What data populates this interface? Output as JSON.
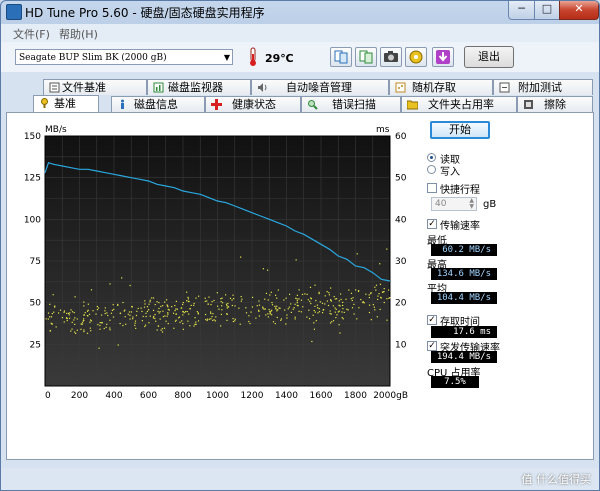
{
  "window": {
    "title": "HD Tune Pro 5.60 - 硬盘/固态硬盘实用程序",
    "minimize": "─",
    "maximize": "□",
    "close": "✕"
  },
  "menu": [
    {
      "label": "文件(F)"
    },
    {
      "label": "帮助(H)"
    }
  ],
  "toolbar": {
    "drive": "Seagate BUP Slim BK (2000 gB)",
    "temperature": "29℃",
    "exit_label": "退出"
  },
  "tabs_top": [
    {
      "label": "文件基准",
      "icon": "file-benchmark-icon"
    },
    {
      "label": "磁盘监视器",
      "icon": "disk-monitor-icon"
    },
    {
      "label": "自动噪音管理",
      "icon": "speaker-icon"
    },
    {
      "label": "随机存取",
      "icon": "random-access-icon"
    },
    {
      "label": "附加测试",
      "icon": "extra-tests-icon"
    }
  ],
  "tabs_bottom": [
    {
      "label": "基准",
      "icon": "benchmark-icon"
    },
    {
      "label": "磁盘信息",
      "icon": "info-icon"
    },
    {
      "label": "健康状态",
      "icon": "health-icon"
    },
    {
      "label": "错误扫描",
      "icon": "error-scan-icon"
    },
    {
      "label": "文件夹占用率",
      "icon": "folder-icon"
    },
    {
      "label": "擦除",
      "icon": "erase-icon"
    }
  ],
  "controls": {
    "start_label": "开始",
    "read_label": "读取",
    "write_label": "写入",
    "read_selected": true,
    "quick_label": "快捷行程",
    "quick_checked": false,
    "quick_value": "40",
    "quick_unit": "gB",
    "transfer_label": "传输速率",
    "transfer_checked": true,
    "min_label": "最低",
    "min_value": "60.2 MB/s",
    "max_label": "最高",
    "max_value": "134.6 MB/s",
    "avg_label": "平均",
    "avg_value": "104.4 MB/s",
    "access_label": "存取时间",
    "access_checked": true,
    "access_value": "17.6 ms",
    "burst_label": "突发传输速率",
    "burst_checked": true,
    "burst_value": "194.4 MB/s",
    "cpu_label": "CPU 占用率",
    "cpu_value": "7.5%"
  },
  "watermark": "值 什么值得买",
  "colors": {
    "transfer_line": "#2aa8e0",
    "access_points": "#e8e84a",
    "plot_bg": "#1c1c1c",
    "grid": "#3a3a3a"
  },
  "chart_data": {
    "type": "line",
    "y_left_label": "MB/s",
    "y_right_label": "ms",
    "x_unit": "gB",
    "x_ticks": [
      "0",
      "200",
      "400",
      "600",
      "800",
      "1000",
      "1200",
      "1400",
      "1600",
      "1800",
      "2000gB"
    ],
    "y_left_ticks": [
      "25",
      "50",
      "75",
      "100",
      "125",
      "150"
    ],
    "y_right_ticks": [
      "10",
      "20",
      "30",
      "40",
      "50",
      "60"
    ],
    "xlim": [
      0,
      2000
    ],
    "ylim_left": [
      0,
      150
    ],
    "ylim_right": [
      0,
      60
    ],
    "grid": true,
    "series": [
      {
        "name": "传输速率",
        "axis": "left",
        "x": [
          0,
          20,
          50,
          100,
          150,
          200,
          250,
          300,
          350,
          400,
          450,
          500,
          550,
          600,
          650,
          700,
          750,
          800,
          850,
          900,
          950,
          1000,
          1050,
          1100,
          1150,
          1200,
          1250,
          1300,
          1350,
          1400,
          1450,
          1500,
          1550,
          1600,
          1650,
          1700,
          1750,
          1800,
          1850,
          1900,
          1950,
          2000
        ],
        "values": [
          128,
          134,
          133,
          132,
          131,
          130,
          130,
          129,
          128,
          127,
          126,
          125,
          124,
          123,
          121,
          120,
          119,
          117,
          116,
          115,
          113,
          111,
          110,
          108,
          106,
          104,
          102,
          100,
          98,
          96,
          93,
          91,
          88,
          85,
          82,
          78,
          76,
          72,
          71,
          68,
          64,
          63
        ]
      },
      {
        "name": "存取时间",
        "axis": "right",
        "kind": "scatter",
        "approx_band": {
          "x_start": 0,
          "x_end": 2000,
          "ms_low_start": 12,
          "ms_high_start": 20,
          "ms_low_end": 15,
          "ms_high_end": 26
        }
      }
    ]
  }
}
